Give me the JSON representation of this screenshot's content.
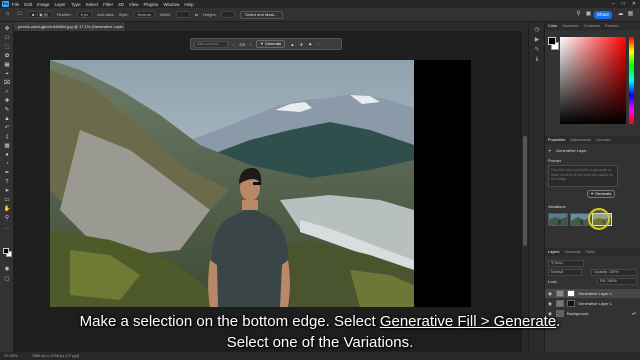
{
  "app": {
    "logo": "Ps",
    "menu": [
      "File",
      "Edit",
      "Image",
      "Layer",
      "Type",
      "Select",
      "Filter",
      "3D",
      "View",
      "Plugins",
      "Window",
      "Help"
    ]
  },
  "options_bar": {
    "feather_label": "Feather:",
    "feather_value": "0 px",
    "antialias_label": "Anti-alias",
    "style_label": "Style:",
    "style_value": "Normal",
    "width_label": "Width:",
    "height_label": "Height:",
    "select_mask_label": "Select and Mask...",
    "share_label": "Share"
  },
  "document": {
    "tab_title": "pexels-ostof-gjhoni-848664.jpg @ 17.1% (Generative Layer 1, RGB/8) *"
  },
  "context_bar": {
    "prompt_placeholder": "Add a prompt...",
    "variation_counter": "2/3",
    "generate_label": "Generate"
  },
  "panels": {
    "color_tabs": [
      "Color",
      "Swatches",
      "Gradients",
      "Patterns"
    ],
    "properties_tabs": [
      "Properties",
      "Adjustments",
      "Libraries"
    ],
    "properties_layer_label": "Generative Layer",
    "prompt_heading": "Prompt",
    "prompt_placeholder": "Describe what you'd like to generate or leave blank to fill the selection based on the image",
    "generate_label": "Generate",
    "variations_heading": "Variations",
    "layers_tabs": [
      "Layers",
      "Channels",
      "Paths"
    ],
    "blend_mode": "Normal",
    "opacity_label": "Opacity: 100%",
    "fill_label": "Fill: 100%",
    "lock_label": "Lock:",
    "layers": [
      {
        "name": "Generative Layer 1",
        "selected": true
      },
      {
        "name": "Generative Layer 1",
        "selected": false
      },
      {
        "name": "Background",
        "selected": false
      }
    ]
  },
  "status_bar": {
    "zoom": "17.09%",
    "doc_info": "7956 px x 4768 px (72 ppi)"
  },
  "caption": {
    "line1_prefix": "Make a selection on the bottom edge. Select ",
    "line1_link": "Generative Fill > Generate",
    "line1_suffix": ".",
    "line2": "Select one of the Variations."
  },
  "colors": {
    "accent": "#1473e6",
    "ps_blue": "#31a8ff",
    "highlight_ring": "#d9c62a"
  }
}
